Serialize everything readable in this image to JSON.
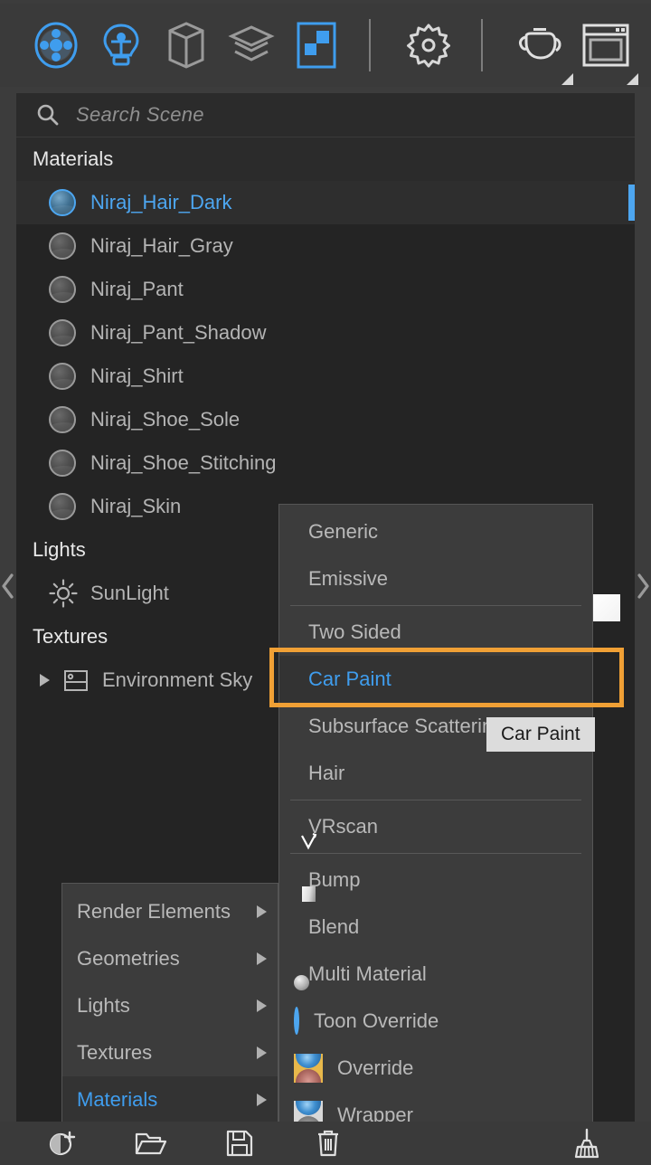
{
  "toolbar": {
    "items": [
      {
        "name": "materials-icon",
        "label": "Materials",
        "active": true
      },
      {
        "name": "lights-icon",
        "label": "Lights",
        "active": true
      },
      {
        "name": "geometry-icon",
        "label": "Geometries",
        "active": false
      },
      {
        "name": "layers-icon",
        "label": "Layers",
        "active": false
      },
      {
        "name": "render-elements-icon",
        "label": "Render Elements",
        "active": true
      },
      {
        "name": "settings-gear-icon",
        "label": "Settings",
        "active": false
      },
      {
        "name": "teapot-icon",
        "label": "Teapot Preview",
        "active": false
      },
      {
        "name": "viewport-icon",
        "label": "Viewport",
        "active": false
      }
    ],
    "accent_color": "#3f9dee",
    "inactive_color": "#b0b0b0"
  },
  "search": {
    "placeholder": "Search Scene",
    "value": "",
    "icon": "search-icon"
  },
  "tree": {
    "groups": [
      {
        "title": "Materials",
        "rows": [
          {
            "label": "Niraj_Hair_Dark",
            "selected": true
          },
          {
            "label": "Niraj_Hair_Gray",
            "selected": false
          },
          {
            "label": "Niraj_Pant",
            "selected": false
          },
          {
            "label": "Niraj_Pant_Shadow",
            "selected": false
          },
          {
            "label": "Niraj_Shirt",
            "selected": false
          },
          {
            "label": "Niraj_Shoe_Sole",
            "selected": false
          },
          {
            "label": "Niraj_Shoe_Stitching",
            "selected": false
          },
          {
            "label": "Niraj_Skin",
            "selected": false
          }
        ]
      },
      {
        "title": "Lights",
        "rows": [
          {
            "label": "SunLight",
            "selected": false
          }
        ]
      },
      {
        "title": "Textures",
        "rows": [
          {
            "label": "Environment Sky",
            "selected": false,
            "expandable": true
          }
        ]
      }
    ]
  },
  "material_menu": {
    "items": [
      {
        "label": "Generic",
        "icon": "sphere-blue-icon",
        "active": false
      },
      {
        "label": "Emissive",
        "icon": "sphere-yellow-icon",
        "active": false
      },
      {
        "divider": true
      },
      {
        "label": "Two Sided",
        "icon": "sphere-twotone-icon",
        "active": false
      },
      {
        "label": "Car Paint",
        "icon": "sphere-carpaint-icon",
        "active": true
      },
      {
        "label": "Subsurface Scattering",
        "icon": "sphere-skin-icon",
        "active": false
      },
      {
        "label": "Hair",
        "icon": "sphere-hair-icon",
        "active": false
      },
      {
        "divider": true
      },
      {
        "label": "VRscan",
        "icon": "vrscan-icon",
        "active": false
      },
      {
        "divider": true
      },
      {
        "label": "Bump",
        "icon": "bump-icon",
        "active": false
      },
      {
        "label": "Blend",
        "icon": "blend-icon",
        "active": false
      },
      {
        "label": "Multi Material",
        "icon": "multi-material-icon",
        "active": false
      },
      {
        "label": "Toon Override",
        "icon": "toon-override-icon",
        "active": false
      },
      {
        "label": "Override",
        "icon": "override-icon",
        "active": false
      },
      {
        "label": "Wrapper",
        "icon": "wrapper-icon",
        "active": false
      }
    ],
    "highlight_color": "#f0a035",
    "active_color": "#3f9dee"
  },
  "context_menu": {
    "items": [
      {
        "label": "Render Elements",
        "active": false
      },
      {
        "label": "Geometries",
        "active": false
      },
      {
        "label": "Lights",
        "active": false
      },
      {
        "label": "Textures",
        "active": false
      },
      {
        "label": "Materials",
        "active": true
      }
    ]
  },
  "tooltip": {
    "text": "Car Paint"
  },
  "bottom_bar": {
    "items": [
      {
        "name": "add-material-icon",
        "label": "Add Material"
      },
      {
        "name": "open-folder-icon",
        "label": "Open"
      },
      {
        "name": "save-icon",
        "label": "Save"
      },
      {
        "name": "delete-icon",
        "label": "Delete"
      },
      {
        "name": "cleanup-broom-icon",
        "label": "Clean Up"
      }
    ]
  },
  "side_nav": {
    "left_arrow": "chevron-left-icon",
    "right_arrow": "chevron-right-icon",
    "swatch_color": "#ffffff"
  }
}
